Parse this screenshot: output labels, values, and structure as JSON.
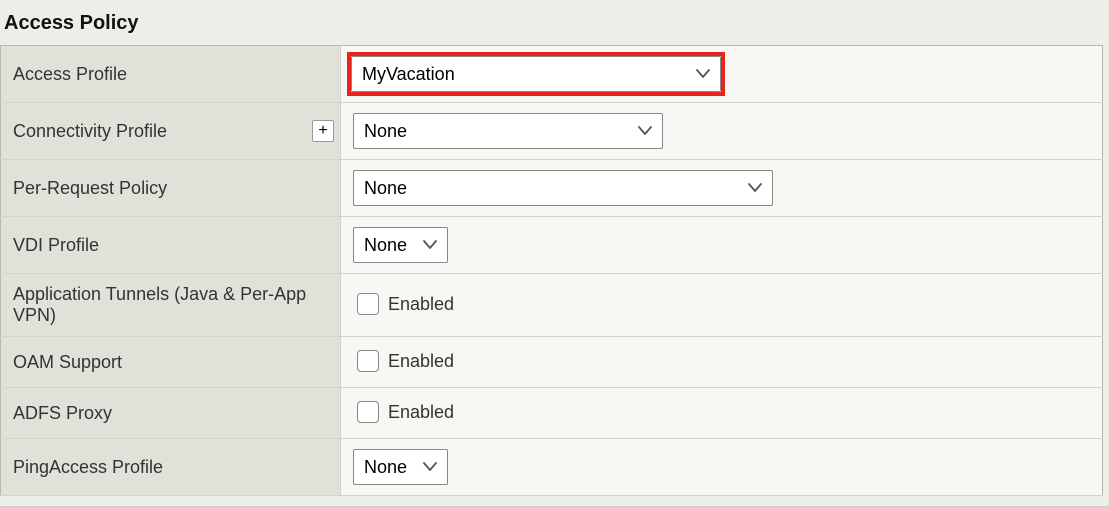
{
  "section_title": "Access Policy",
  "rows": {
    "access_profile": {
      "label": "Access Profile",
      "value": "MyVacation"
    },
    "connectivity_profile": {
      "label": "Connectivity Profile",
      "add_button": "+",
      "value": "None"
    },
    "per_request_policy": {
      "label": "Per-Request Policy",
      "value": "None"
    },
    "vdi_profile": {
      "label": "VDI Profile",
      "value": "None"
    },
    "app_tunnels": {
      "label": "Application Tunnels (Java & Per-App VPN)",
      "checkbox_label": "Enabled",
      "checked": false
    },
    "oam_support": {
      "label": "OAM Support",
      "checkbox_label": "Enabled",
      "checked": false
    },
    "adfs_proxy": {
      "label": "ADFS Proxy",
      "checkbox_label": "Enabled",
      "checked": false
    },
    "pingaccess_profile": {
      "label": "PingAccess Profile",
      "value": "None"
    }
  }
}
